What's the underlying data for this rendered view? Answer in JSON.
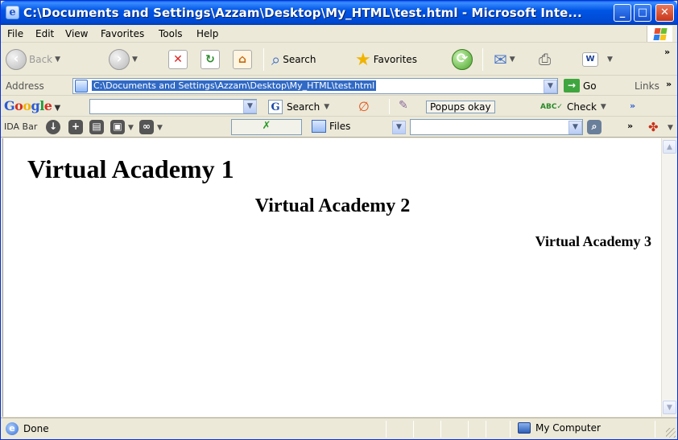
{
  "window": {
    "title": "C:\\Documents and Settings\\Azzam\\Desktop\\My_HTML\\test.html - Microsoft Inte...",
    "minimize": "_",
    "maximize": "□",
    "close": "✕"
  },
  "menu": {
    "items": [
      "File",
      "Edit",
      "View",
      "Favorites",
      "Tools",
      "Help"
    ]
  },
  "toolbar": {
    "back": "Back",
    "search": "Search",
    "favorites": "Favorites"
  },
  "address": {
    "label": "Address",
    "url": "C:\\Documents and Settings\\Azzam\\Desktop\\My_HTML\\test.html",
    "go": "Go",
    "links": "Links"
  },
  "google_bar": {
    "logo": "Google",
    "search": "Search",
    "popups": "Popups okay",
    "check": "Check"
  },
  "ida_bar": {
    "label": "IDA Bar",
    "files": "Files"
  },
  "page": {
    "heading1": "Virtual Academy 1",
    "heading2": "Virtual Academy 2",
    "heading3": "Virtual Academy 3"
  },
  "status": {
    "text": "Done",
    "zone": "My Computer"
  },
  "colors": {
    "titlebar": "#0055e5",
    "chrome": "#ece9d8",
    "selection": "#316ac5"
  }
}
